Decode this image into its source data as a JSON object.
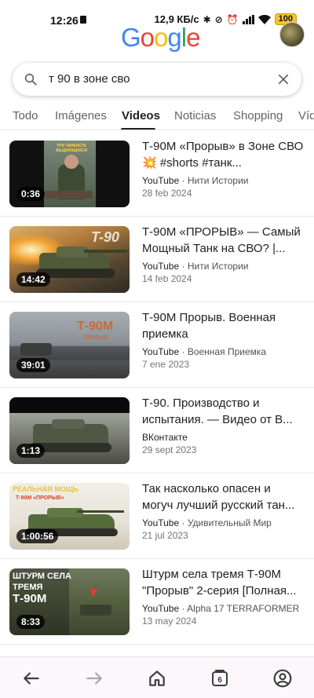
{
  "status_bar": {
    "time": "12:26",
    "net_speed": "12,9 КБ/с",
    "battery": "100"
  },
  "header": {
    "logo_text": "Google"
  },
  "search": {
    "query": "т 90 в зоне сво"
  },
  "tabs": [
    {
      "label": "Todo"
    },
    {
      "label": "Imágenes"
    },
    {
      "label": "Videos"
    },
    {
      "label": "Noticias"
    },
    {
      "label": "Shopping"
    },
    {
      "label": "Víd"
    }
  ],
  "results": [
    {
      "title": "Т-90М «Прорыв» в Зоне СВО💥 #shorts #танк...",
      "source": "YouTube",
      "channel": "Нити Истории",
      "date": "28 feb 2024",
      "duration": "0:36"
    },
    {
      "title": "Т-90М «ПРОРЫВ» — Самый Мощный Танк на СВО? |...",
      "source": "YouTube",
      "channel": "Нити Истории",
      "date": "14 feb 2024",
      "duration": "14:42"
    },
    {
      "title": "Т-90М Прорыв. Военная приемка",
      "source": "YouTube",
      "channel": "Военная Приемка",
      "date": "7 ene 2023",
      "duration": "39:01"
    },
    {
      "title": "Т-90. Производство и испытания. — Видео от В...",
      "source": "ВКонтакте",
      "channel": "",
      "date": "29 sept 2023",
      "duration": "1:13"
    },
    {
      "title": "Так насколько опасен и могуч лучший русский тан...",
      "source": "YouTube",
      "channel": "Удивительный Мир",
      "date": "21 jul 2023",
      "duration": "1:00:56"
    },
    {
      "title": "Штурм села тремя Т-90М \"Прорыв\" 2-серия [Полная...",
      "source": "YouTube",
      "channel": "Alpha 17 TERRAFORMER",
      "date": "13 may 2024",
      "duration": "8:33"
    }
  ],
  "thumb_text": {
    "t0_banner": "ТРИ ТАНКИСТА ВЫДАЮЩИХСЯ",
    "t1_overlay": "T-90",
    "t2_overlay": "Т-90М",
    "t2_sub": "ПРОРЫВ",
    "t4_top": "РЕАЛЬНАЯ МОЩЬ",
    "t4_sub": "Т-90М «ПРОРЫВ»",
    "t5_line1": "ШТУРМ СЕЛА",
    "t5_line2": "ТРЕМЯ",
    "t5_line3": "Т-90М"
  },
  "bottom_nav": {
    "tab_count": "6"
  },
  "colors": {
    "google_blue": "#4285F4",
    "google_red": "#EA4335",
    "google_yellow": "#FBBC05",
    "google_green": "#34A853"
  }
}
